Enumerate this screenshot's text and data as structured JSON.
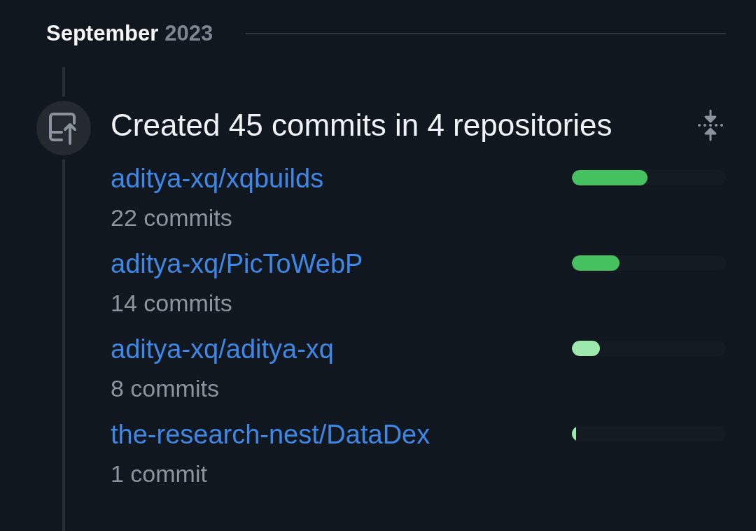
{
  "month_header": {
    "month": "September",
    "year": "2023"
  },
  "activity": {
    "title": "Created 45 commits in 4 repositories",
    "expanded": true,
    "repositories": [
      {
        "name": "aditya-xq/xqbuilds",
        "commits": "22 commits",
        "level": 0.49,
        "color": "#45c25f"
      },
      {
        "name": "aditya-xq/PicToWebP",
        "commits": "14 commits",
        "level": 0.31,
        "color": "#45c25f"
      },
      {
        "name": "aditya-xq/aditya-xq",
        "commits": "8 commits",
        "level": 0.18,
        "color": "#9de8ad"
      },
      {
        "name": "the-research-nest/DataDex",
        "commits": "1 commit",
        "level": 0.025,
        "color": "#9de8ad"
      }
    ]
  }
}
